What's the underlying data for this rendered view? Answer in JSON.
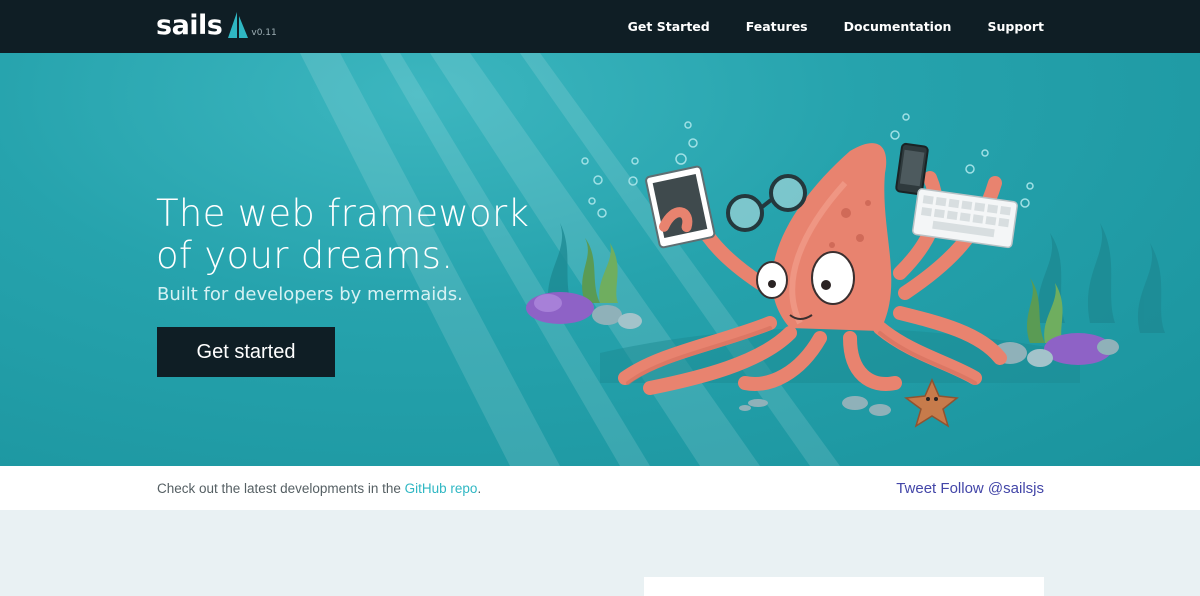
{
  "navbar": {
    "logo_text": "sails",
    "version": "v0.11",
    "links": [
      "Get Started",
      "Features",
      "Documentation",
      "Support"
    ]
  },
  "hero": {
    "headline_line1": "The web framework",
    "headline_line2": "of your dreams.",
    "tagline": "Built for developers by mermaids.",
    "cta_label": "Get started"
  },
  "info_strip": {
    "text_before": "Check out the latest developments in the ",
    "link_label": "GitHub repo",
    "text_after": ".",
    "tweet_label": "Tweet",
    "follow_label": "Follow @sailsjs"
  },
  "colors": {
    "nav_bg": "#0f1e25",
    "hero_teal": "#26a3ad",
    "squid": "#e8836f",
    "link_teal": "#2fb7c3",
    "social_blue": "#4346a8"
  },
  "icons": [
    "sail-logo-icon",
    "squid-mascot-illustration",
    "tablet-icon",
    "phone-icon",
    "keyboard-icon",
    "glasses-icon",
    "starfish-icon"
  ]
}
